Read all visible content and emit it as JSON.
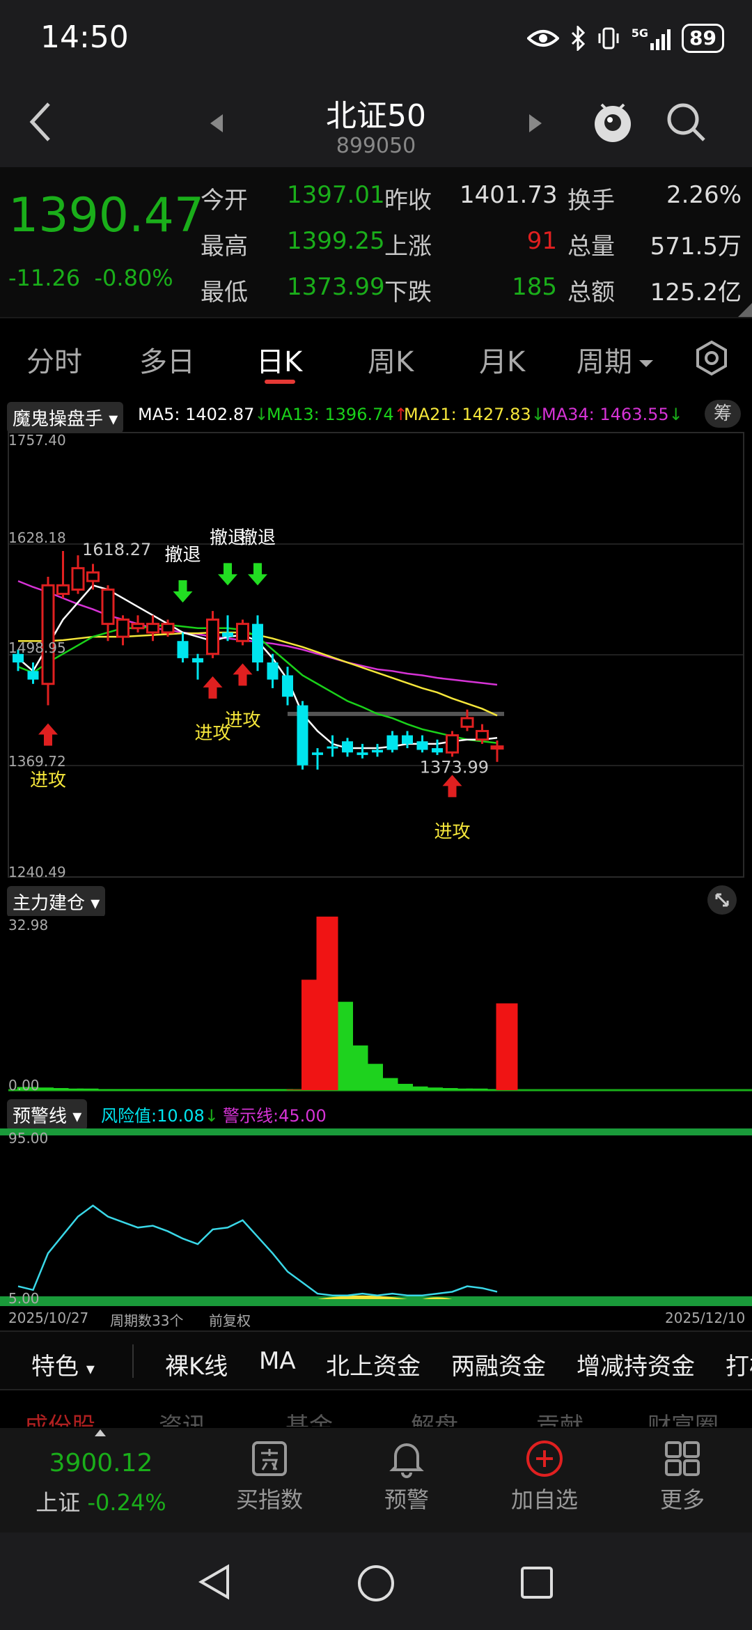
{
  "status": {
    "time": "14:50",
    "battery": "89",
    "network": "5G"
  },
  "header": {
    "title": "北证50",
    "code": "899050"
  },
  "quote": {
    "price": "1390.47",
    "change": "-11.26",
    "change_pct": "-0.80%",
    "open_label": "今开",
    "open": "1397.01",
    "high_label": "最高",
    "high": "1399.25",
    "low_label": "最低",
    "low": "1373.99",
    "prev_close_label": "昨收",
    "prev_close": "1401.73",
    "up_label": "上涨",
    "up": "91",
    "down_label": "下跌",
    "down": "185",
    "turnover_label": "换手",
    "turnover": "2.26%",
    "volume_label": "总量",
    "volume": "571.5万",
    "amount_label": "总额",
    "amount": "125.2亿"
  },
  "tabs": [
    "分时",
    "多日",
    "日K",
    "周K",
    "月K",
    "周期"
  ],
  "active_tab": "日K",
  "main_chart": {
    "indicator": "魔鬼操盘手",
    "ma5": "MA5: 1402.87",
    "ma13": "MA13: 1396.74",
    "ma21": "MA21: 1427.83",
    "ma34": "MA34: 1463.55",
    "chip_btn": "筹",
    "y_labels": [
      "1757.40",
      "1628.18",
      "1498.95",
      "1369.72",
      "1240.49"
    ],
    "high_mark": "1618.27",
    "low_mark": "1373.99",
    "retreat_label": "撤退",
    "attack_label": "进攻"
  },
  "sub_chart1": {
    "indicator": "主力建仓",
    "y_top": "32.98",
    "y_bottom": "0.00"
  },
  "sub_chart2": {
    "indicator": "预警线",
    "risk": "风险值:10.08",
    "warn": "警示线:45.00",
    "y_top": "95.00",
    "y_bottom": "5.00"
  },
  "xaxis": {
    "start": "2025/10/27",
    "periods": "周期数33个",
    "adjust": "前复权",
    "end": "2025/12/10"
  },
  "bottom_tabs": [
    "特色",
    "裸K线",
    "MA",
    "北上资金",
    "两融资金",
    "增减持资金",
    "打板"
  ],
  "sub_tabs": [
    "成份股",
    "资讯",
    "基金",
    "解盘",
    "贡献",
    "财富圈"
  ],
  "index": {
    "value": "3900.12",
    "name": "上证",
    "change": "-0.24%"
  },
  "bottom_nav": [
    "买指数",
    "预警",
    "加自选",
    "更多"
  ],
  "colors": {
    "up": "#e02020",
    "down": "#1aae1a",
    "cyan": "#00e5ee",
    "yellow": "#f5e63a",
    "magenta": "#d633d6",
    "white": "#ffffff"
  },
  "chart_data": {
    "type": "candlestick",
    "x_range": [
      "2025/10/27",
      "2025/12/10"
    ],
    "y_range": [
      1240.49,
      1757.4
    ],
    "candles": [
      {
        "o": 1500,
        "h": 1505,
        "l": 1480,
        "c": 1490,
        "dir": "down"
      },
      {
        "o": 1480,
        "h": 1490,
        "l": 1465,
        "c": 1470,
        "dir": "down"
      },
      {
        "o": 1465,
        "h": 1590,
        "l": 1440,
        "c": 1580,
        "dir": "up"
      },
      {
        "o": 1570,
        "h": 1620,
        "l": 1565,
        "c": 1580,
        "dir": "up"
      },
      {
        "o": 1575,
        "h": 1615,
        "l": 1570,
        "c": 1600,
        "dir": "up"
      },
      {
        "o": 1585,
        "h": 1605,
        "l": 1575,
        "c": 1595,
        "dir": "up"
      },
      {
        "o": 1575,
        "h": 1580,
        "l": 1515,
        "c": 1535,
        "dir": "up"
      },
      {
        "o": 1520,
        "h": 1545,
        "l": 1510,
        "c": 1540,
        "dir": "up"
      },
      {
        "o": 1530,
        "h": 1545,
        "l": 1525,
        "c": 1535,
        "dir": "up"
      },
      {
        "o": 1525,
        "h": 1545,
        "l": 1515,
        "c": 1535,
        "dir": "up"
      },
      {
        "o": 1525,
        "h": 1540,
        "l": 1520,
        "c": 1535,
        "dir": "up"
      },
      {
        "o": 1515,
        "h": 1525,
        "l": 1490,
        "c": 1495,
        "dir": "down"
      },
      {
        "o": 1495,
        "h": 1500,
        "l": 1470,
        "c": 1490,
        "dir": "down"
      },
      {
        "o": 1500,
        "h": 1550,
        "l": 1495,
        "c": 1540,
        "dir": "up"
      },
      {
        "o": 1525,
        "h": 1545,
        "l": 1515,
        "c": 1520,
        "dir": "down"
      },
      {
        "o": 1515,
        "h": 1540,
        "l": 1510,
        "c": 1535,
        "dir": "up"
      },
      {
        "o": 1535,
        "h": 1545,
        "l": 1480,
        "c": 1490,
        "dir": "down"
      },
      {
        "o": 1490,
        "h": 1500,
        "l": 1460,
        "c": 1470,
        "dir": "down"
      },
      {
        "o": 1475,
        "h": 1485,
        "l": 1440,
        "c": 1450,
        "dir": "down"
      },
      {
        "o": 1440,
        "h": 1445,
        "l": 1365,
        "c": 1370,
        "dir": "down"
      },
      {
        "o": 1385,
        "h": 1390,
        "l": 1365,
        "c": 1382,
        "dir": "down"
      },
      {
        "o": 1390,
        "h": 1405,
        "l": 1380,
        "c": 1392,
        "dir": "down"
      },
      {
        "o": 1398,
        "h": 1402,
        "l": 1380,
        "c": 1385,
        "dir": "down"
      },
      {
        "o": 1385,
        "h": 1395,
        "l": 1378,
        "c": 1382,
        "dir": "down"
      },
      {
        "o": 1385,
        "h": 1395,
        "l": 1380,
        "c": 1388,
        "dir": "down"
      },
      {
        "o": 1388,
        "h": 1410,
        "l": 1385,
        "c": 1405,
        "dir": "down"
      },
      {
        "o": 1395,
        "h": 1410,
        "l": 1390,
        "c": 1405,
        "dir": "down"
      },
      {
        "o": 1388,
        "h": 1405,
        "l": 1385,
        "c": 1398,
        "dir": "down"
      },
      {
        "o": 1390,
        "h": 1400,
        "l": 1382,
        "c": 1385,
        "dir": "down"
      },
      {
        "o": 1385,
        "h": 1410,
        "l": 1380,
        "c": 1405,
        "dir": "up"
      },
      {
        "o": 1415,
        "h": 1435,
        "l": 1410,
        "c": 1425,
        "dir": "up"
      },
      {
        "o": 1400,
        "h": 1418,
        "l": 1395,
        "c": 1410,
        "dir": "up"
      },
      {
        "o": 1392,
        "h": 1399,
        "l": 1374,
        "c": 1390,
        "dir": "up"
      }
    ],
    "ma_white": [
      1495,
      1480,
      1510,
      1540,
      1560,
      1580,
      1575,
      1565,
      1555,
      1545,
      1535,
      1525,
      1520,
      1515,
      1520,
      1522,
      1515,
      1495,
      1470,
      1430,
      1410,
      1395,
      1390,
      1390,
      1390,
      1392,
      1395,
      1395,
      1395,
      1398,
      1400,
      1400,
      1402
    ],
    "ma_green": [
      1485,
      1478,
      1490,
      1500,
      1510,
      1520,
      1525,
      1530,
      1530,
      1532,
      1534,
      1532,
      1530,
      1530,
      1530,
      1528,
      1520,
      1505,
      1490,
      1475,
      1465,
      1455,
      1445,
      1438,
      1430,
      1425,
      1418,
      1412,
      1408,
      1404,
      1400,
      1398,
      1396
    ],
    "ma_yellow": [
      1515,
      1515,
      1515,
      1516,
      1518,
      1520,
      1520,
      1520,
      1521,
      1522,
      1523,
      1524,
      1524,
      1525,
      1525,
      1525,
      1522,
      1518,
      1513,
      1508,
      1502,
      1496,
      1490,
      1484,
      1478,
      1472,
      1466,
      1460,
      1455,
      1448,
      1442,
      1436,
      1428
    ],
    "ma_magenta": [
      1585,
      1578,
      1572,
      1565,
      1558,
      1552,
      1545,
      1540,
      1535,
      1530,
      1528,
      1525,
      1523,
      1520,
      1518,
      1516,
      1514,
      1512,
      1509,
      1505,
      1500,
      1495,
      1490,
      1486,
      1482,
      1480,
      1477,
      1475,
      1472,
      1470,
      1468,
      1466,
      1464
    ],
    "attack_idx": [
      2,
      13,
      15,
      29
    ],
    "retreat_idx": [
      11,
      14,
      16
    ],
    "volume_bar": {
      "y_range": [
        0,
        32.98
      ],
      "red": [
        {
          "i": 18,
          "v": 0.1
        },
        {
          "i": 19,
          "v": 21
        },
        {
          "i": 20,
          "v": 33
        },
        {
          "i": 32,
          "v": 16.5
        }
      ],
      "green": [
        {
          "i": 0,
          "v": 0.6
        },
        {
          "i": 1,
          "v": 0.5
        },
        {
          "i": 2,
          "v": 0.4
        },
        {
          "i": 3,
          "v": 0.3
        },
        {
          "i": 4,
          "v": 0.3
        },
        {
          "i": 5,
          "v": 0.2
        },
        {
          "i": 6,
          "v": 0.2
        },
        {
          "i": 7,
          "v": 0.2
        },
        {
          "i": 8,
          "v": 0.2
        },
        {
          "i": 9,
          "v": 0.2
        },
        {
          "i": 10,
          "v": 0.2
        },
        {
          "i": 11,
          "v": 0.2
        },
        {
          "i": 12,
          "v": 0.2
        },
        {
          "i": 13,
          "v": 0.2
        },
        {
          "i": 14,
          "v": 0.2
        },
        {
          "i": 15,
          "v": 0.2
        },
        {
          "i": 16,
          "v": 0.2
        },
        {
          "i": 17,
          "v": 0.2
        },
        {
          "i": 21,
          "v": 16.8
        },
        {
          "i": 22,
          "v": 8.5
        },
        {
          "i": 23,
          "v": 5
        },
        {
          "i": 24,
          "v": 2.3
        },
        {
          "i": 25,
          "v": 1.2
        },
        {
          "i": 26,
          "v": 0.7
        },
        {
          "i": 27,
          "v": 0.5
        },
        {
          "i": 28,
          "v": 0.4
        },
        {
          "i": 29,
          "v": 0.3
        },
        {
          "i": 30,
          "v": 0.3
        },
        {
          "i": 31,
          "v": 0.2
        }
      ]
    },
    "risk_line": {
      "y_range": [
        5,
        95
      ],
      "values": [
        12,
        10,
        30,
        40,
        50,
        56,
        50,
        47,
        44,
        45,
        42,
        38,
        35,
        43,
        44,
        48,
        39,
        30,
        20,
        14,
        8,
        7,
        7,
        8,
        7,
        8,
        7,
        7,
        8,
        9,
        12,
        11,
        9
      ]
    }
  }
}
